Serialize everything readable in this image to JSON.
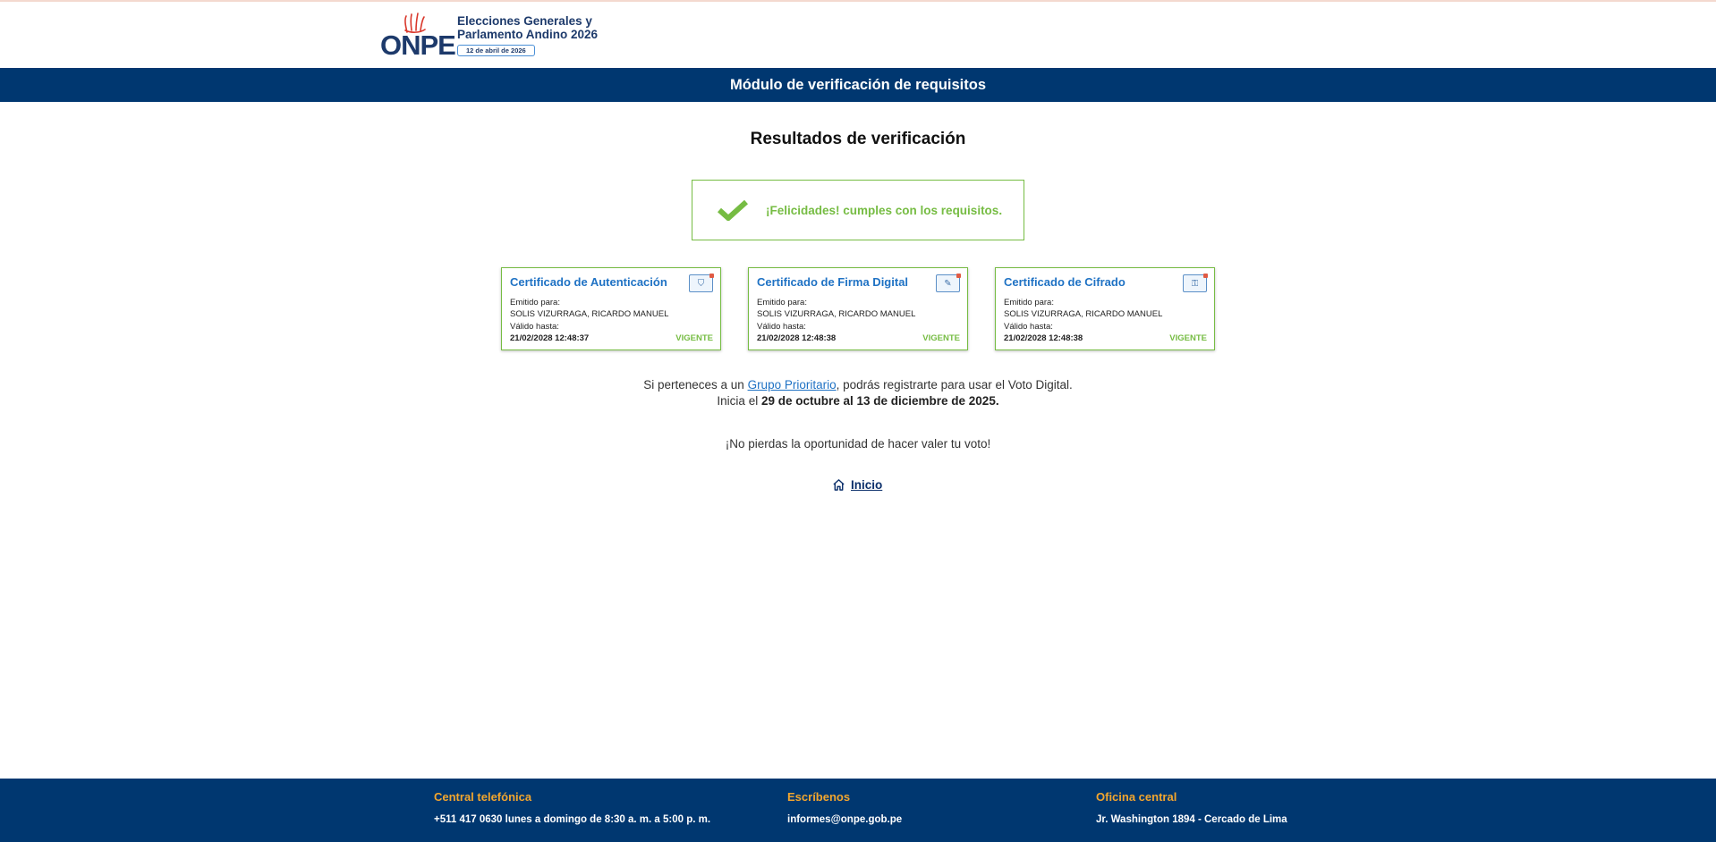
{
  "header": {
    "logo_text": "ONPE",
    "event_title": "Elecciones Generales y Parlamento Andino 2026",
    "event_date": "12 de abril de 2026"
  },
  "title_bar": "Módulo de verificación de requisitos",
  "results_title": "Resultados de verificación",
  "success_message": "¡Felicidades! cumples con los requisitos.",
  "certificates": [
    {
      "title": "Certificado de Autenticación",
      "icon": "shield-icon",
      "issued_label": "Emitido para:",
      "issued_to": "SOLIS VIZURRAGA, RICARDO MANUEL",
      "valid_label": "Válido hasta:",
      "valid_until": "21/02/2028 12:48:37",
      "status": "VIGENTE"
    },
    {
      "title": "Certificado de Firma Digital",
      "icon": "signature-icon",
      "issued_label": "Emitido para:",
      "issued_to": "SOLIS VIZURRAGA, RICARDO MANUEL",
      "valid_label": "Válido hasta:",
      "valid_until": "21/02/2028 12:48:38",
      "status": "VIGENTE"
    },
    {
      "title": "Certificado de Cifrado",
      "icon": "encryption-icon",
      "issued_label": "Emitido para:",
      "issued_to": "SOLIS VIZURRAGA, RICARDO MANUEL",
      "valid_label": "Válido hasta:",
      "valid_until": "21/02/2028 12:48:38",
      "status": "VIGENTE"
    }
  ],
  "info": {
    "line1_before": "Si perteneces a un ",
    "line1_link": "Grupo Prioritario",
    "line1_after": ", podrás registrarte para usar el Voto Digital.",
    "line2_before": "Inicia el ",
    "line2_bold": "29 de octubre al 13 de diciembre de 2025.",
    "line3": "¡No pierdas la oportunidad de hacer valer tu voto!"
  },
  "home_link": "Inicio",
  "footer": {
    "phone_heading": "Central telefónica",
    "phone_text": "+511 417 0630 lunes a domingo de 8:30 a. m. a 5:00 p. m.",
    "email_heading": "Escríbenos",
    "email_text": "informes@onpe.gob.pe",
    "office_heading": "Oficina central",
    "office_text": "Jr. Washington 1894 - Cercado de Lima"
  },
  "colors": {
    "navy": "#003770",
    "success_green": "#76bc43",
    "link_blue": "#1f72c4",
    "footer_heading": "#f2a62e"
  }
}
